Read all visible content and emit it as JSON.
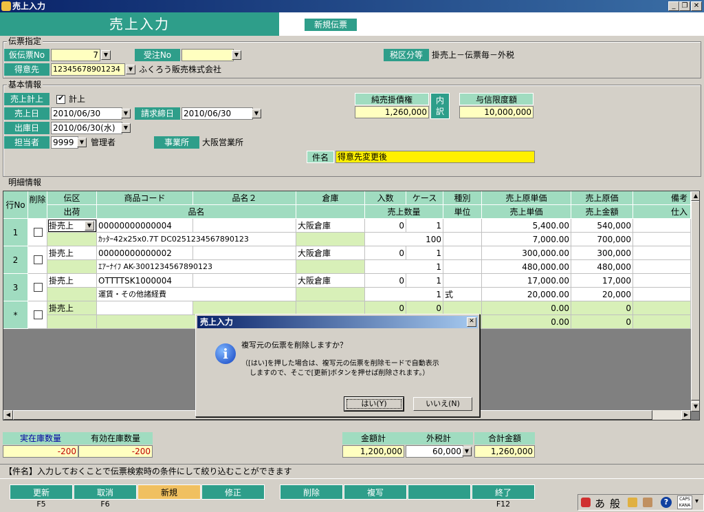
{
  "window": {
    "title": "売上入力"
  },
  "header": {
    "title": "売上入力",
    "mode_badge": "新規伝票"
  },
  "slip": {
    "group_label": "伝票指定",
    "temp_slip_no_label": "仮伝票No",
    "temp_slip_no": "7",
    "order_no_label": "受注No",
    "order_no": "",
    "tax_label": "税区分等",
    "tax_value": "掛売上－伝票毎－外税",
    "customer_label": "得意先",
    "customer_code": "12345678901234",
    "customer_name": "ふくろう販売株式会社"
  },
  "basic": {
    "group_label": "基本情報",
    "sales_post_label": "売上計上",
    "sales_post_check": "計上",
    "sales_date_label": "売上日",
    "sales_date": "2010/06/30",
    "billing_close_label": "請求締日",
    "billing_close": "2010/06/30",
    "ship_date_label": "出庫日",
    "ship_date": "2010/06/30(水)",
    "staff_label": "担当者",
    "staff_code": "9999",
    "staff_name": "管理者",
    "office_label": "事業所",
    "office_name": "大阪営業所",
    "receivable_label": "純売掛債権",
    "receivable_value": "1,260,000",
    "detail_button": "内訳",
    "credit_label": "与信限度額",
    "credit_value": "10,000,000",
    "subject_label": "件名",
    "subject_value": "得意先変更後"
  },
  "detail": {
    "group_label": "明細情報",
    "headers_top": [
      "行No",
      "削除",
      "伝区",
      "商品コード",
      "品名２",
      "倉庫",
      "入数",
      "ケース",
      "種別",
      "売上原単価",
      "売上原価",
      "備考"
    ],
    "headers_bottom": [
      "出荷",
      "品名",
      "売上数量",
      "単位",
      "売上単価",
      "売上金額",
      "仕入"
    ],
    "rows": [
      {
        "no": "1",
        "kubun": "掛売上",
        "code": "00000000000004",
        "name2": "",
        "warehouse": "大阪倉庫",
        "irisu": "0",
        "case": "1",
        "kind": "",
        "cost_unit": "5,400.00",
        "cost": "540,000",
        "name": "ｶｯﾀｰ42x25x0.7T DC0251234567890123",
        "qty": "100",
        "unit": "",
        "price": "7,000.00",
        "amount": "700,000"
      },
      {
        "no": "2",
        "kubun": "掛売上",
        "code": "00000000000002",
        "name2": "",
        "warehouse": "大阪倉庫",
        "irisu": "0",
        "case": "1",
        "kind": "",
        "cost_unit": "300,000.00",
        "cost": "300,000",
        "name": "ｴｱｰﾅｲﾌ AK-3001234567890123",
        "qty": "1",
        "unit": "",
        "price": "480,000.00",
        "amount": "480,000"
      },
      {
        "no": "3",
        "kubun": "掛売上",
        "code": "OTTTTSK1000004",
        "name2": "",
        "warehouse": "大阪倉庫",
        "irisu": "0",
        "case": "1",
        "kind": "",
        "cost_unit": "17,000.00",
        "cost": "17,000",
        "name": "運賃・その他諸経費",
        "qty": "1",
        "unit": "式",
        "price": "20,000.00",
        "amount": "20,000"
      },
      {
        "no": "*",
        "kubun": "掛売上",
        "code": "",
        "name2": "",
        "warehouse": "",
        "irisu": "0",
        "case": "0",
        "kind": "",
        "cost_unit": "0.00",
        "cost": "0",
        "name": "",
        "qty": "",
        "unit": "",
        "price": "0.00",
        "amount": "0"
      }
    ]
  },
  "footer": {
    "stock_label": "実在庫数量",
    "stock_value": "-200",
    "avail_label": "有効在庫数量",
    "avail_value": "-200",
    "amount_total_label": "金額計",
    "amount_total": "1,200,000",
    "tax_total_label": "外税計",
    "tax_total": "60,000",
    "grand_total_label": "合計金額",
    "grand_total": "1,260,000"
  },
  "hint": "【件名】入力しておくことで伝票検索時の条件にして絞り込むことができます",
  "fkeys": [
    {
      "label": "更新",
      "key": "F5"
    },
    {
      "label": "取消",
      "key": "F6"
    },
    {
      "label": "新規",
      "key": ""
    },
    {
      "label": "修正",
      "key": ""
    },
    {
      "label": "削除",
      "key": ""
    },
    {
      "label": "複写",
      "key": ""
    },
    {
      "label": "",
      "key": ""
    },
    {
      "label": "終了",
      "key": "F12"
    }
  ],
  "dialog": {
    "title": "売上入力",
    "message": "複写元の伝票を削除しますか？",
    "note_line1": "（[はい]を押した場合は、複写元の伝票を削除モードで自動表示",
    "note_line2": "しますので、そこで[更新]ボタンを押せば削除されます。）",
    "yes_button": "はい(Y)",
    "no_button": "いいえ(N)"
  },
  "ime": {
    "mode": "あ",
    "kind": "般",
    "caps": "CAPS",
    "kana": "KANA"
  },
  "colors": {
    "accent": "#2e9e8a",
    "header_cell": "#a0dcc0",
    "input_bg": "#ffffc0",
    "title_bar": "#0a246a"
  }
}
